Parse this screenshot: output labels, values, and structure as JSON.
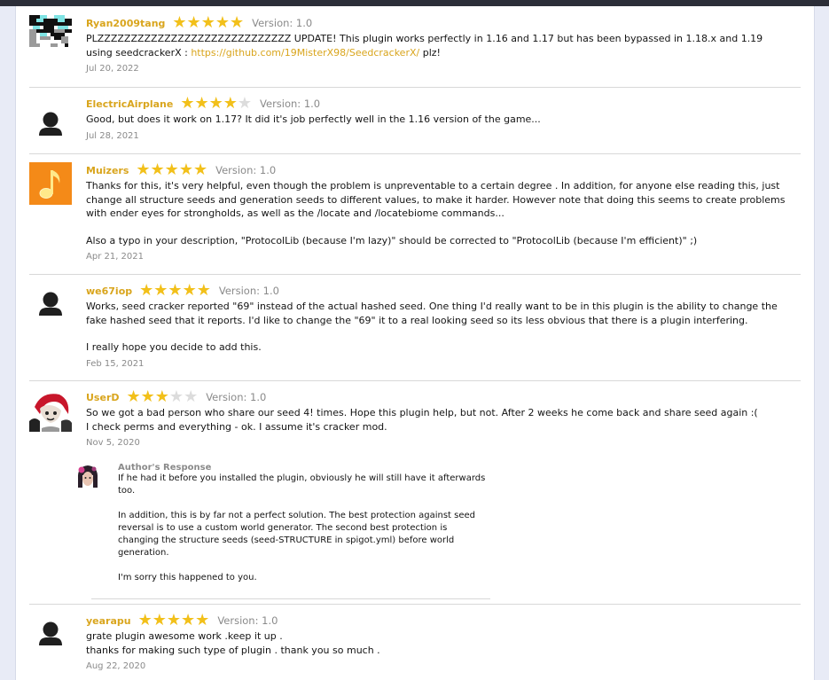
{
  "reviews": [
    {
      "author": "Ryan2009tang",
      "rating": 5,
      "version": "Version: 1.0",
      "message_pre": "PLZZZZZZZZZZZZZZZZZZZZZZZZZZZZZ UPDATE! This plugin works perfectly in 1.16 and 1.17 but has been bypassed in 1.18.x and 1.19 using seedcrackerX : ",
      "link": "https://github.com/19MisterX98/SeedcrackerX/",
      "message_post": " plz!",
      "date": "Jul 20, 2022",
      "avatar": "pixel-avatar"
    },
    {
      "author": "ElectricAirplane",
      "rating": 4,
      "version": "Version: 1.0",
      "message": "Good, but does it work on 1.17? It did it's job perfectly well in the 1.16 version of the game...",
      "date": "Jul 28, 2021",
      "avatar": "default-user-icon"
    },
    {
      "author": "Muizers",
      "rating": 5,
      "version": "Version: 1.0",
      "message": "Thanks for this, it's very helpful, even though the problem is unpreventable to a certain degree . In addition, for anyone else reading this, just change all structure seeds and generation seeds to different values, to make it harder. However note that doing this seems to create problems with ender eyes for strongholds, as well as the /locate and /locatebiome commands...",
      "message2": "Also a typo in your description, \"ProtocolLib (because I'm lazy)\" should be corrected to \"ProtocolLib (because I'm efficient)\" ;)",
      "date": "Apr 21, 2021",
      "avatar": "music-note-avatar"
    },
    {
      "author": "we67iop",
      "rating": 5,
      "version": "Version: 1.0",
      "message": "Works, seed cracker reported \"69\" instead of the actual hashed seed. One thing I'd really want to be in this plugin is the ability to change the fake hashed seed that it reports. I'd like to change the \"69\" it to a real looking seed so its less obvious that there is a plugin interfering.",
      "message2": "I really hope you decide to add this.",
      "date": "Feb 15, 2021",
      "avatar": "default-user-icon"
    },
    {
      "author": "UserD",
      "rating": 3,
      "version": "Version: 1.0",
      "message": "So we got a bad person who share our seed 4! times. Hope this plugin help, but not. After 2 weeks he come back and share seed again :(",
      "message_line2": "I check perms and everything - ok. I assume it's cracker mod.",
      "date": "Nov 5, 2020",
      "avatar": "anime-avatar",
      "response": {
        "title": "Author's Response",
        "p1": "If he had it before you installed the plugin, obviously he will still have it afterwards too.",
        "p2": "In addition, this is by far not a perfect solution. The best protection against seed reversal is to use a custom world generator. The second best protection is changing the structure seeds (seed-STRUCTURE in spigot.yml) before world generation.",
        "p3": "I'm sorry this happened to you."
      }
    },
    {
      "author": "yearapu",
      "rating": 5,
      "version": "Version: 1.0",
      "message": "grate plugin awesome work .keep it up .",
      "message_line2": "thanks for making such type of plugin . thank you so much .",
      "date": "Aug 22, 2020",
      "avatar": "default-user-icon"
    }
  ]
}
